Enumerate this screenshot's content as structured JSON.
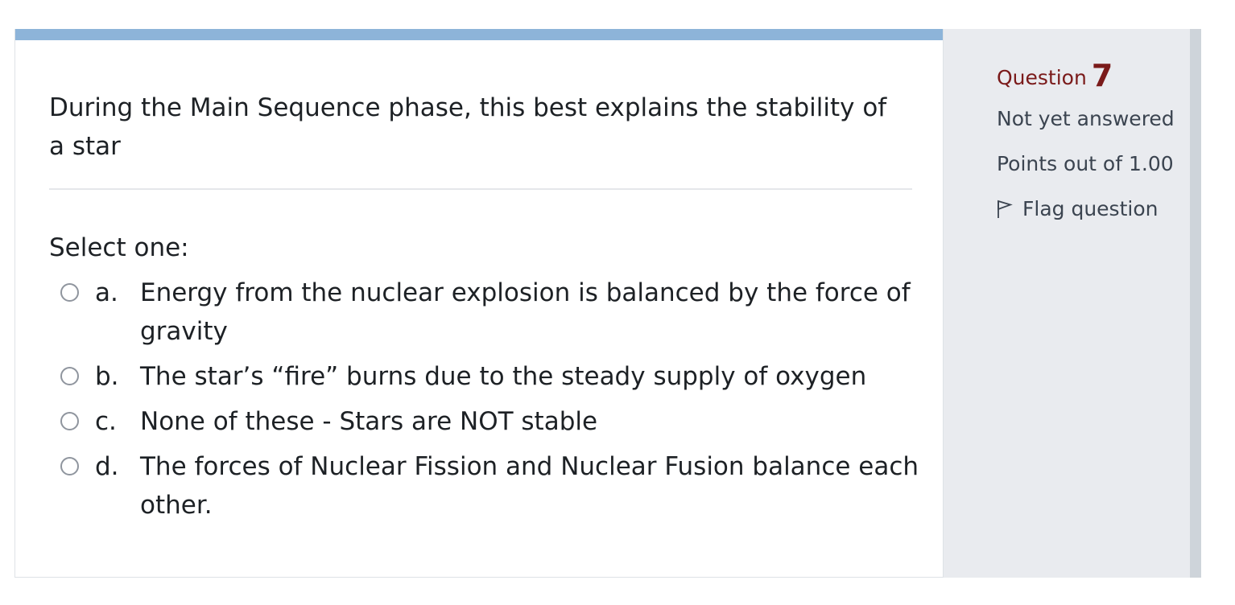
{
  "question": {
    "text": "During the Main Sequence phase, this best explains the stability of a star",
    "prompt": "Select one:",
    "options": [
      {
        "letter": "a.",
        "text": "Energy from the nuclear explosion is balanced by the force of gravity"
      },
      {
        "letter": "b.",
        "text": "The star’s “fire” burns due to the steady supply of oxygen"
      },
      {
        "letter": "c.",
        "text": "None of these - Stars are NOT stable"
      },
      {
        "letter": "d.",
        "text": "The forces of Nuclear Fission and Nuclear Fusion balance each other."
      }
    ]
  },
  "info": {
    "question_label": "Question",
    "question_number": "7",
    "state": "Not yet answered",
    "grade": "Points out of 1.00",
    "flag_label": "Flag question",
    "flag_icon": "flag-outline-icon"
  },
  "colors": {
    "accent_bar": "#8db4d9",
    "question_number": "#7a1a1a",
    "info_panel": "#e9ebef"
  }
}
